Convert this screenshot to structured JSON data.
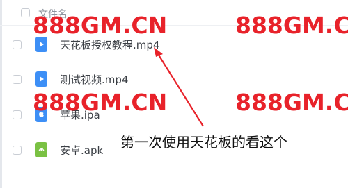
{
  "header": {
    "column_name": "文件名"
  },
  "files": [
    {
      "name": "天花板授权教程.mp4",
      "icon": "video-file-icon",
      "color": "#3d8ff6"
    },
    {
      "name": "测试视频.mp4",
      "icon": "video-file-icon",
      "color": "#3d8ff6"
    },
    {
      "name": "苹果.ipa",
      "icon": "apple-app-icon",
      "color": "#3d8ff6"
    },
    {
      "name": "安卓.apk",
      "icon": "android-app-icon",
      "color": "#7ac143"
    }
  ],
  "watermark": {
    "text": "888GM.CN",
    "color": "#e8222a"
  },
  "annotation": {
    "text": "第一次使用天花板的看这个"
  }
}
